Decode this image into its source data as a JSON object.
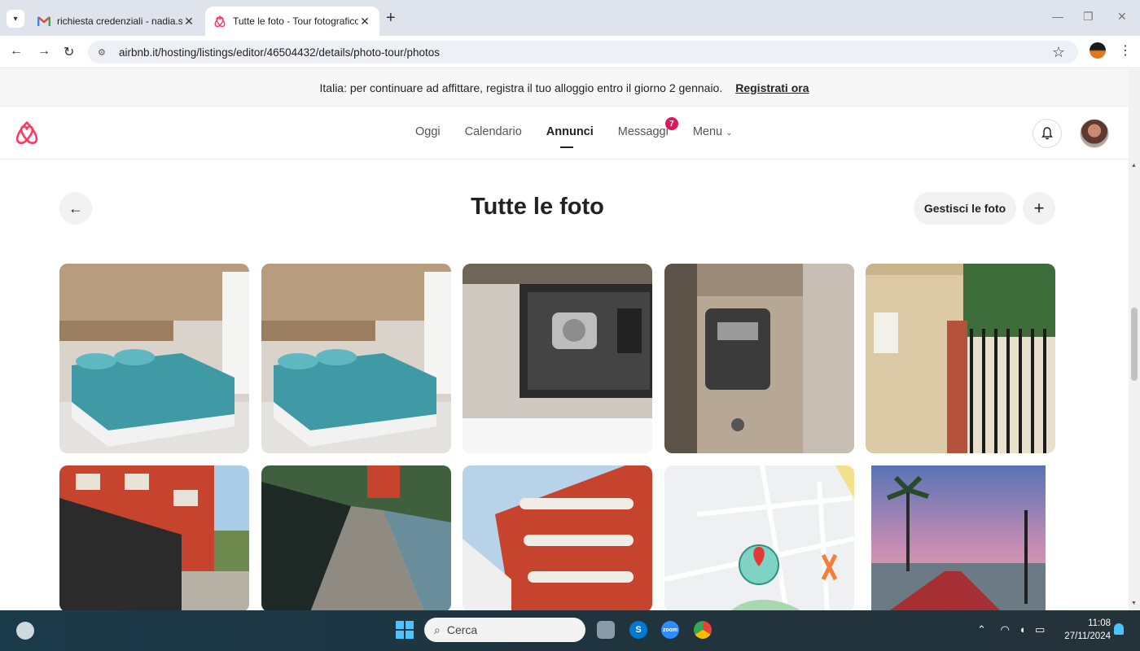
{
  "browser": {
    "tabs": [
      {
        "title": "richiesta credenziali - nadia.scac",
        "active": false
      },
      {
        "title": "Tutte le foto - Tour fotografico",
        "active": true
      }
    ],
    "url": "airbnb.it/hosting/listings/editor/46504432/details/photo-tour/photos"
  },
  "banner": {
    "text": "Italia: per continuare ad affittare, registra il tuo alloggio entro il giorno 2 gennaio.",
    "link": "Registrati ora"
  },
  "header": {
    "nav": [
      "Oggi",
      "Calendario",
      "Annunci",
      "Messaggi",
      "Menu"
    ],
    "active_nav": "Annunci",
    "messages_badge": "7"
  },
  "page": {
    "title": "Tutte le foto",
    "manage_label": "Gestisci le foto"
  },
  "photos": [
    "bedroom-1",
    "bedroom-2",
    "safe",
    "key-lockbox",
    "entrance-gate",
    "building-fence",
    "rooftop-walkway",
    "building-facade",
    "map",
    "seafront-promenade"
  ],
  "taskbar": {
    "search_placeholder": "Cerca",
    "time": "11:08",
    "date": "27/11/2024"
  },
  "colors": {
    "brand": "#FF385C",
    "badge": "#E0155B"
  }
}
